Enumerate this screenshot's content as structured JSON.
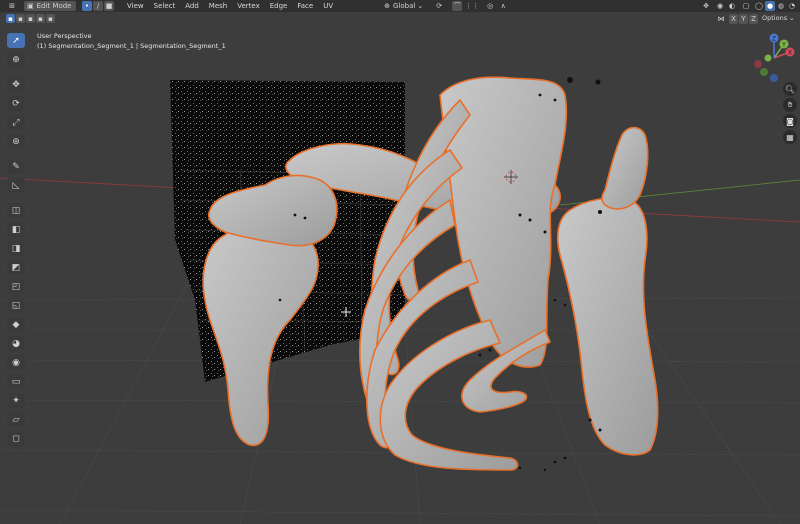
{
  "header": {
    "mode_label": "Edit Mode",
    "menu": [
      "View",
      "Select",
      "Add",
      "Mesh",
      "Vertex",
      "Edge",
      "Face",
      "UV"
    ],
    "transform_orientation": "Global",
    "axis_buttons": [
      "X",
      "Y",
      "Z"
    ],
    "options_label": "Options"
  },
  "viewport": {
    "view_name": "User Perspective",
    "object_info": "(1) Segmentation_Segment_1 | Segmentation_Segment_1"
  },
  "gizmo": {
    "x_label": "X",
    "y_label": "Y",
    "z_label": "Z"
  },
  "icons": [
    "editor-type-icon",
    "select-box-icon",
    "cursor-icon",
    "move-icon",
    "rotate-icon",
    "scale-icon",
    "transform-icon",
    "annotate-icon",
    "measure-icon",
    "add-cube-icon",
    "extrude-icon",
    "inset-icon",
    "bevel-icon",
    "loop-cut-icon",
    "knife-icon",
    "poly-build-icon",
    "spin-icon",
    "smooth-icon",
    "edge-slide-icon",
    "shrink-fatten-icon",
    "shear-icon",
    "rip-icon",
    "zoom-icon",
    "hand-icon",
    "camera-icon",
    "grid-icon"
  ],
  "colors": {
    "selection_outline": "#e8702a",
    "viewport_bg": "#3d3d3d",
    "active_blue": "#4772b3"
  }
}
